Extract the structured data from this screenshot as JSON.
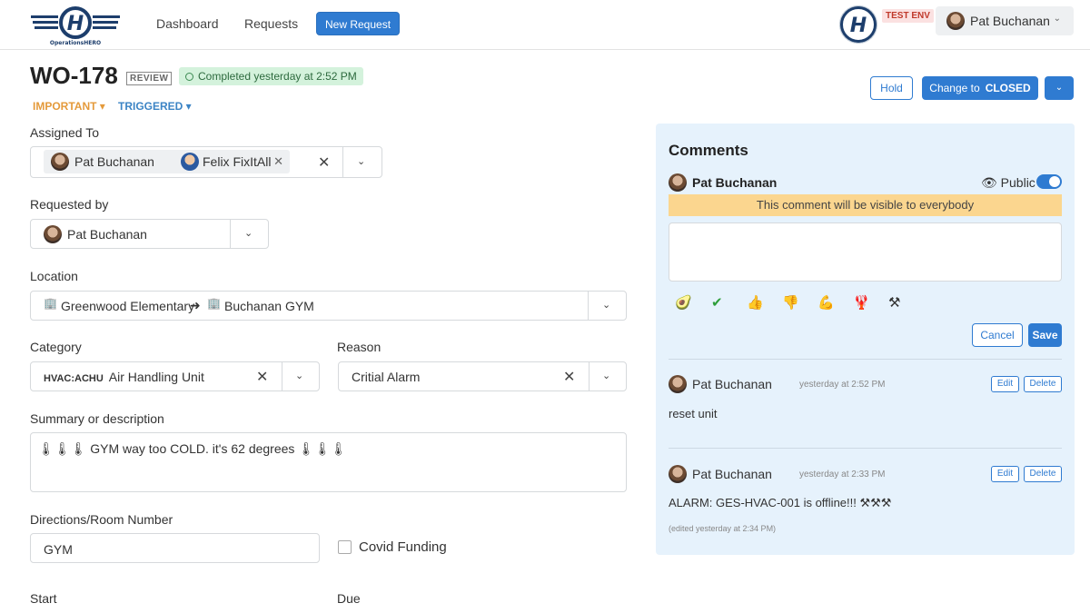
{
  "nav": {
    "dashboard": "Dashboard",
    "requests": "Requests",
    "new_request": "New Request",
    "env_badge": "TEST ENV",
    "user_name": "Pat Buchanan",
    "user_chev": "⌄"
  },
  "header": {
    "wo_number": "WO-178",
    "review_badge": "REVIEW",
    "status_text": "Completed yesterday at 2:52 PM",
    "tag_priority": "IMPORTANT ▾",
    "tag_trigger": "TRIGGERED ▾",
    "hold_label": "Hold",
    "change_prefix": "Change to",
    "change_target": "CLOSED",
    "drop_glyph": "⌄"
  },
  "form": {
    "assigned_label": "Assigned To",
    "assignees": [
      "Pat Buchanan",
      "Felix FixItAll"
    ],
    "requested_by_label": "Requested by",
    "requested_by": "Pat Buchanan",
    "location_label": "Location",
    "location_from": "Greenwood Elementary",
    "location_arrow": "➜",
    "location_to": "Buchanan GYM",
    "category_label": "Category",
    "category_code": "HVAC:ACHU",
    "category_name": "Air Handling Unit",
    "reason_label": "Reason",
    "reason_value": "Critial Alarm",
    "summary_label": "Summary or description",
    "summary_text": "🌡🌡🌡 GYM way too COLD. it's 62 degrees 🌡🌡🌡",
    "directions_label": "Directions/Room Number",
    "directions_value": "GYM",
    "covid_label": "Covid Funding",
    "start_label": "Start",
    "due_label": "Due"
  },
  "comments": {
    "title": "Comments",
    "composer_author": "Pat Buchanan",
    "public_label": "Public",
    "visibility_note": "This comment will be visible to everybody",
    "emojis": [
      "🥑",
      "✔",
      "👍",
      "👎",
      "💪",
      "🦞",
      "⚒"
    ],
    "cancel_label": "Cancel",
    "save_label": "Save",
    "edit_label": "Edit",
    "delete_label": "Delete",
    "items": [
      {
        "author": "Pat Buchanan",
        "time": "yesterday at 2:52 PM",
        "body": "reset unit",
        "edited": ""
      },
      {
        "author": "Pat Buchanan",
        "time": "yesterday at 2:33 PM",
        "body": "ALARM: GES-HVAC-001 is offline!!! ⚒⚒⚒",
        "edited": "(edited yesterday at 2:34 PM)"
      }
    ]
  },
  "colors": {
    "primary": "#2f7bd1",
    "important": "#e49a3b",
    "triggered": "#3c84c5",
    "success_bg": "#d4f2dc",
    "panel_bg": "#e6f2fc",
    "warning_bg": "#fbd68f"
  },
  "icons": {
    "logo": "operations-hero-logo",
    "status": "check-circle-icon",
    "eye": "eye-icon",
    "building": "building-icon"
  }
}
